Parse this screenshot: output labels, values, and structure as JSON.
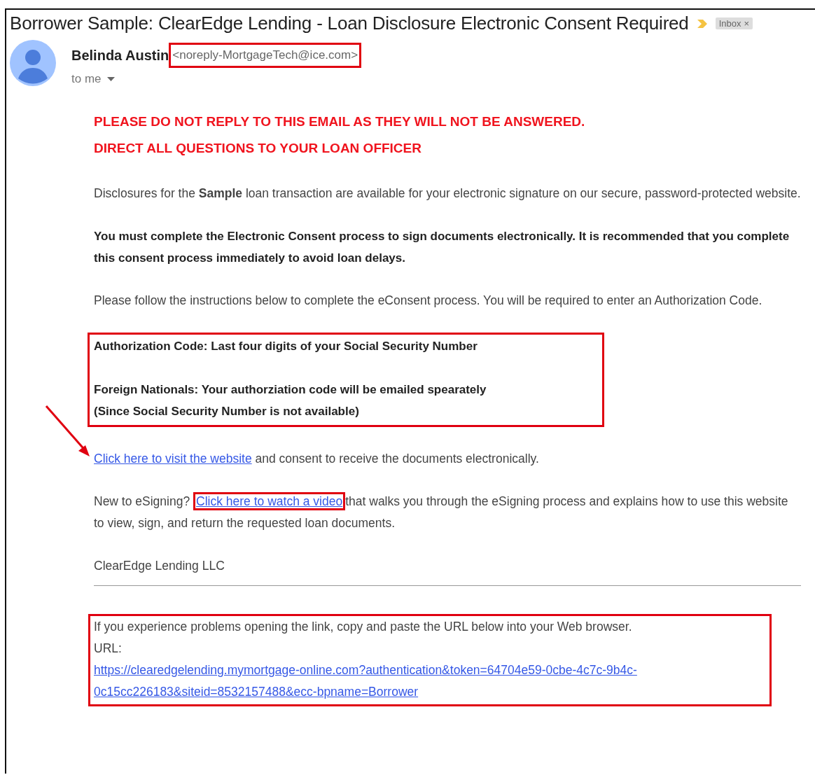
{
  "email": {
    "subject": "Borrower Sample: ClearEdge Lending - Loan Disclosure Electronic Consent Required",
    "label_chip": {
      "text": "Inbox",
      "close": "×"
    },
    "sender": {
      "name": "Belinda Austin",
      "address": "<noreply-MortgageTech@ice.com>",
      "address_highlighted": true,
      "recipient": "to me"
    },
    "warnings": [
      "PLEASE DO NOT REPLY TO THIS EMAIL AS THEY WILL NOT BE ANSWERED.",
      "DIRECT ALL QUESTIONS TO YOUR LOAN OFFICER"
    ],
    "paragraphs": [
      {
        "kind": "plain",
        "text": "Disclosures for the  **Sample** loan transaction are available for your electronic signature on our secure, password-protected website."
      },
      {
        "kind": "bold",
        "text": "You must complete the Electronic Consent process to sign documents electronically.  It is recommended that you complete this consent process immediately to avoid loan delays."
      },
      {
        "kind": "plain",
        "text": "Please follow the instructions below to complete the eConsent process.  You will be required to enter an Authorization Code."
      }
    ],
    "auth_box": {
      "highlighted": true,
      "groups": [
        [
          "Authorization Code:  Last four digits of your Social Security Number"
        ],
        [
          "Foreign Nationals:  Your authorziation code will be emailed spearately",
          "(Since Social Security Number is not available)"
        ]
      ]
    },
    "website_line": {
      "link": "Click here to visit the website",
      "rest": " and consent to receive the documents electronically.",
      "arrow": true
    },
    "video_line": {
      "before": "New to eSigning? ",
      "link": "Click here to watch a video",
      "link_highlighted": true,
      "rest": "that walks you through the eSigning process and explains how to use this website to view, sign, and return the requested loan documents."
    },
    "signature": "ClearEdge Lending LLC",
    "footer": {
      "highlighted": true,
      "note": "If you experience problems opening the link, copy and paste the URL below into your Web browser.",
      "url_label": "URL:",
      "url": "https://clearedgelending.mymortgage-online.com?authentication&token=64704e59-0cbe-4c7c-9b4c-0c15cc226183&siteid=8532157488&ecc-bpname=Borrower"
    }
  }
}
